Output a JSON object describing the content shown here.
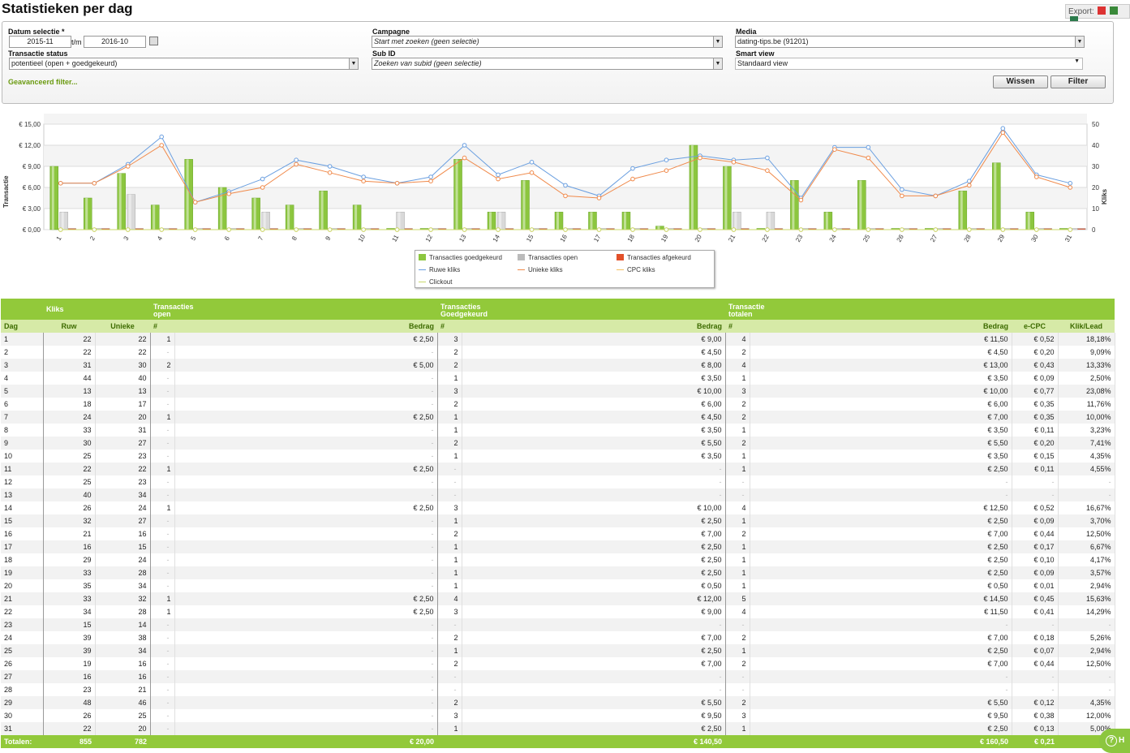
{
  "page": {
    "title": "Statistieken per dag"
  },
  "export": {
    "label": "Export:",
    "icons": [
      "pdf-icon",
      "excel-icon",
      "csv-icon"
    ]
  },
  "filters": {
    "datum_label": "Datum selectie *",
    "date_from": "2015-11",
    "tm": "t/m",
    "date_to": "2016-10",
    "status_label": "Transactie status",
    "status_value": "potentieel (open + goedgekeurd)",
    "campagne_label": "Campagne",
    "campagne_value": "Start met zoeken (geen selectie)",
    "subid_label": "Sub ID",
    "subid_value": "Zoeken van subid (geen selectie)",
    "media_label": "Media",
    "media_value": "dating-tips.be (91201)",
    "smartview_label": "Smart view",
    "smartview_value": "Standaard view",
    "advanced": "Geavanceerd filter...",
    "btn_wissen": "Wissen",
    "btn_filter": "Filter"
  },
  "chart_data": {
    "type": "bar+line",
    "categories": [
      "1",
      "2",
      "3",
      "4",
      "5",
      "6",
      "7",
      "8",
      "9",
      "10",
      "11",
      "12",
      "13",
      "14",
      "15",
      "16",
      "17",
      "18",
      "19",
      "20",
      "21",
      "22",
      "23",
      "24",
      "25",
      "26",
      "27",
      "28",
      "29",
      "30",
      "31"
    ],
    "ylabel": "Transactie",
    "y2label": "Kliks",
    "ylim": [
      0,
      15
    ],
    "y2lim": [
      0,
      50
    ],
    "yticks": [
      "€ 0,00",
      "€ 3,00",
      "€ 6,00",
      "€ 9,00",
      "€ 12,00",
      "€ 15,00"
    ],
    "y2ticks": [
      "0",
      "10",
      "20",
      "30",
      "40",
      "50"
    ],
    "series": [
      {
        "name": "Transacties goedgekeurd",
        "kind": "bar",
        "color": "#8cc63f",
        "values": [
          9,
          4.5,
          8,
          3.5,
          10,
          6,
          4.5,
          3.5,
          5.5,
          3.5,
          0,
          0,
          10,
          2.5,
          7,
          2.5,
          2.5,
          2.5,
          0.5,
          12,
          9,
          0,
          7,
          2.5,
          7,
          0,
          0,
          5.5,
          9.5,
          2.5,
          0
        ]
      },
      {
        "name": "Transacties open",
        "kind": "bar",
        "color": "#d9d9d9",
        "values": [
          2.5,
          0,
          5,
          0,
          0,
          0,
          2.5,
          0,
          0,
          0,
          2.5,
          0,
          0,
          2.5,
          0,
          0,
          0,
          0,
          0,
          0,
          2.5,
          2.5,
          0,
          0,
          0,
          0,
          0,
          0,
          0,
          0,
          0
        ]
      },
      {
        "name": "Transacties afgekeurd",
        "kind": "bar",
        "color": "#e2502a",
        "values": [
          0,
          0,
          0,
          0,
          0,
          0,
          0,
          0,
          0,
          0,
          0,
          0,
          0,
          0,
          0,
          0,
          0,
          0,
          0,
          0,
          0,
          0,
          0,
          0,
          0,
          0,
          0,
          0,
          0,
          0,
          0
        ]
      },
      {
        "name": "Ruwe kliks",
        "kind": "line",
        "color": "#6a9fe0",
        "values": [
          22,
          22,
          31,
          44,
          13,
          18,
          24,
          33,
          30,
          25,
          22,
          25,
          40,
          26,
          32,
          21,
          16,
          29,
          33,
          35,
          33,
          34,
          15,
          39,
          39,
          19,
          16,
          23,
          48,
          26,
          22
        ]
      },
      {
        "name": "Unieke kliks",
        "kind": "line",
        "color": "#f08a4b",
        "values": [
          22,
          22,
          30,
          40,
          13,
          17,
          20,
          31,
          27,
          23,
          22,
          23,
          34,
          24,
          27,
          16,
          15,
          24,
          28,
          34,
          32,
          28,
          14,
          38,
          34,
          16,
          16,
          21,
          46,
          25,
          20
        ]
      },
      {
        "name": "CPC kliks",
        "kind": "line",
        "color": "#f5c060",
        "values": [
          0,
          0,
          0,
          0,
          0,
          0,
          0,
          0,
          0,
          0,
          0,
          0,
          0,
          0,
          0,
          0,
          0,
          0,
          0,
          0,
          0,
          0,
          0,
          0,
          0,
          0,
          0,
          0,
          0,
          0,
          0
        ]
      },
      {
        "name": "Clickout",
        "kind": "line",
        "color": "#c8d86a",
        "values": [
          0,
          0,
          0,
          0,
          0,
          0,
          0,
          0,
          0,
          0,
          0,
          0,
          0,
          0,
          0,
          0,
          0,
          0,
          0,
          0,
          0,
          0,
          0,
          0,
          0,
          0,
          0,
          0,
          0,
          0,
          0
        ]
      }
    ],
    "legend": "bottom-center"
  },
  "table": {
    "groups": [
      "Kliks",
      "Transacties\nopen",
      "Transacties\nGoedgekeurd",
      "Transactie\ntotalen"
    ],
    "columns": [
      "Dag",
      "Ruw",
      "Unieke",
      "#",
      "Bedrag",
      "#",
      "Bedrag",
      "#",
      "Bedrag",
      "e-CPC",
      "Klik/Lead"
    ],
    "rows": [
      [
        "1",
        "22",
        "22",
        "1",
        "€ 2,50",
        "3",
        "€ 9,00",
        "4",
        "€ 11,50",
        "€ 0,52",
        "18,18%"
      ],
      [
        "2",
        "22",
        "22",
        "-",
        "-",
        "2",
        "€ 4,50",
        "2",
        "€ 4,50",
        "€ 0,20",
        "9,09%"
      ],
      [
        "3",
        "31",
        "30",
        "2",
        "€ 5,00",
        "2",
        "€ 8,00",
        "4",
        "€ 13,00",
        "€ 0,43",
        "13,33%"
      ],
      [
        "4",
        "44",
        "40",
        "-",
        "-",
        "1",
        "€ 3,50",
        "1",
        "€ 3,50",
        "€ 0,09",
        "2,50%"
      ],
      [
        "5",
        "13",
        "13",
        "-",
        "-",
        "3",
        "€ 10,00",
        "3",
        "€ 10,00",
        "€ 0,77",
        "23,08%"
      ],
      [
        "6",
        "18",
        "17",
        "-",
        "-",
        "2",
        "€ 6,00",
        "2",
        "€ 6,00",
        "€ 0,35",
        "11,76%"
      ],
      [
        "7",
        "24",
        "20",
        "1",
        "€ 2,50",
        "1",
        "€ 4,50",
        "2",
        "€ 7,00",
        "€ 0,35",
        "10,00%"
      ],
      [
        "8",
        "33",
        "31",
        "-",
        "-",
        "1",
        "€ 3,50",
        "1",
        "€ 3,50",
        "€ 0,11",
        "3,23%"
      ],
      [
        "9",
        "30",
        "27",
        "-",
        "-",
        "2",
        "€ 5,50",
        "2",
        "€ 5,50",
        "€ 0,20",
        "7,41%"
      ],
      [
        "10",
        "25",
        "23",
        "-",
        "-",
        "1",
        "€ 3,50",
        "1",
        "€ 3,50",
        "€ 0,15",
        "4,35%"
      ],
      [
        "11",
        "22",
        "22",
        "1",
        "€ 2,50",
        "-",
        "-",
        "1",
        "€ 2,50",
        "€ 0,11",
        "4,55%"
      ],
      [
        "12",
        "25",
        "23",
        "-",
        "-",
        "-",
        "-",
        "-",
        "-",
        "-",
        "-"
      ],
      [
        "13",
        "40",
        "34",
        "-",
        "-",
        "-",
        "-",
        "-",
        "-",
        "-",
        "-"
      ],
      [
        "14",
        "26",
        "24",
        "1",
        "€ 2,50",
        "3",
        "€ 10,00",
        "4",
        "€ 12,50",
        "€ 0,52",
        "16,67%"
      ],
      [
        "15",
        "32",
        "27",
        "-",
        "-",
        "1",
        "€ 2,50",
        "1",
        "€ 2,50",
        "€ 0,09",
        "3,70%"
      ],
      [
        "16",
        "21",
        "16",
        "-",
        "-",
        "2",
        "€ 7,00",
        "2",
        "€ 7,00",
        "€ 0,44",
        "12,50%"
      ],
      [
        "17",
        "16",
        "15",
        "-",
        "-",
        "1",
        "€ 2,50",
        "1",
        "€ 2,50",
        "€ 0,17",
        "6,67%"
      ],
      [
        "18",
        "29",
        "24",
        "-",
        "-",
        "1",
        "€ 2,50",
        "1",
        "€ 2,50",
        "€ 0,10",
        "4,17%"
      ],
      [
        "19",
        "33",
        "28",
        "-",
        "-",
        "1",
        "€ 2,50",
        "1",
        "€ 2,50",
        "€ 0,09",
        "3,57%"
      ],
      [
        "20",
        "35",
        "34",
        "-",
        "-",
        "1",
        "€ 0,50",
        "1",
        "€ 0,50",
        "€ 0,01",
        "2,94%"
      ],
      [
        "21",
        "33",
        "32",
        "1",
        "€ 2,50",
        "4",
        "€ 12,00",
        "5",
        "€ 14,50",
        "€ 0,45",
        "15,63%"
      ],
      [
        "22",
        "34",
        "28",
        "1",
        "€ 2,50",
        "3",
        "€ 9,00",
        "4",
        "€ 11,50",
        "€ 0,41",
        "14,29%"
      ],
      [
        "23",
        "15",
        "14",
        "-",
        "-",
        "-",
        "-",
        "-",
        "-",
        "-",
        "-"
      ],
      [
        "24",
        "39",
        "38",
        "-",
        "-",
        "2",
        "€ 7,00",
        "2",
        "€ 7,00",
        "€ 0,18",
        "5,26%"
      ],
      [
        "25",
        "39",
        "34",
        "-",
        "-",
        "1",
        "€ 2,50",
        "1",
        "€ 2,50",
        "€ 0,07",
        "2,94%"
      ],
      [
        "26",
        "19",
        "16",
        "-",
        "-",
        "2",
        "€ 7,00",
        "2",
        "€ 7,00",
        "€ 0,44",
        "12,50%"
      ],
      [
        "27",
        "16",
        "16",
        "-",
        "-",
        "-",
        "-",
        "-",
        "-",
        "-",
        "-"
      ],
      [
        "28",
        "23",
        "21",
        "-",
        "-",
        "-",
        "-",
        "-",
        "-",
        "-",
        "-"
      ],
      [
        "29",
        "48",
        "46",
        "-",
        "-",
        "2",
        "€ 5,50",
        "2",
        "€ 5,50",
        "€ 0,12",
        "4,35%"
      ],
      [
        "30",
        "26",
        "25",
        "-",
        "-",
        "3",
        "€ 9,50",
        "3",
        "€ 9,50",
        "€ 0,38",
        "12,00%"
      ],
      [
        "31",
        "22",
        "20",
        "-",
        "-",
        "1",
        "€ 2,50",
        "1",
        "€ 2,50",
        "€ 0,13",
        "5,00%"
      ]
    ],
    "totals": [
      "Totalen:",
      "855",
      "782",
      "8",
      "€ 20,00",
      "46",
      "€ 140,50",
      "54",
      "€ 160,50",
      "€ 0,21",
      "6,9"
    ]
  },
  "help": {
    "label": "H"
  }
}
